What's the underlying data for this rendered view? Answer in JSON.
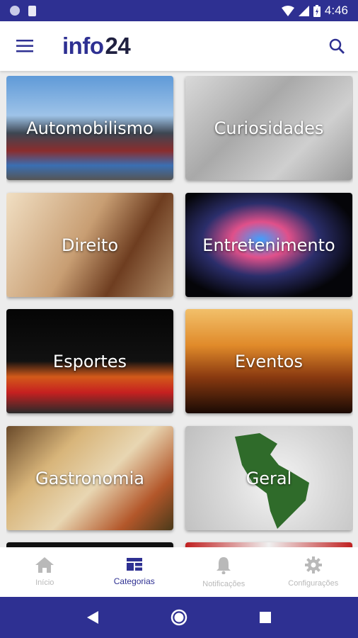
{
  "status_bar": {
    "time": "4:46"
  },
  "app": {
    "logo_text": "info",
    "logo_number": "24"
  },
  "categories": [
    {
      "label": "Automobilismo",
      "image_hint": "cars"
    },
    {
      "label": "Curiosidades",
      "image_hint": "question-marks"
    },
    {
      "label": "Direito",
      "image_hint": "gavel"
    },
    {
      "label": "Entretenimento",
      "image_hint": "media-swirl"
    },
    {
      "label": "Esportes",
      "image_hint": "sports-balls"
    },
    {
      "label": "Eventos",
      "image_hint": "concert-crowd"
    },
    {
      "label": "Gastronomia",
      "image_hint": "spice-map"
    },
    {
      "label": "Geral",
      "image_hint": "globe-americas"
    }
  ],
  "bottom_nav": [
    {
      "label": "Início",
      "icon": "home-icon",
      "active": false
    },
    {
      "label": "Categorias",
      "icon": "categories-icon",
      "active": true
    },
    {
      "label": "Notificações",
      "icon": "bell-icon",
      "active": false
    },
    {
      "label": "Configurações",
      "icon": "gear-icon",
      "active": false
    }
  ],
  "colors": {
    "brand": "#2e3092",
    "inactive": "#b9b9b9"
  }
}
